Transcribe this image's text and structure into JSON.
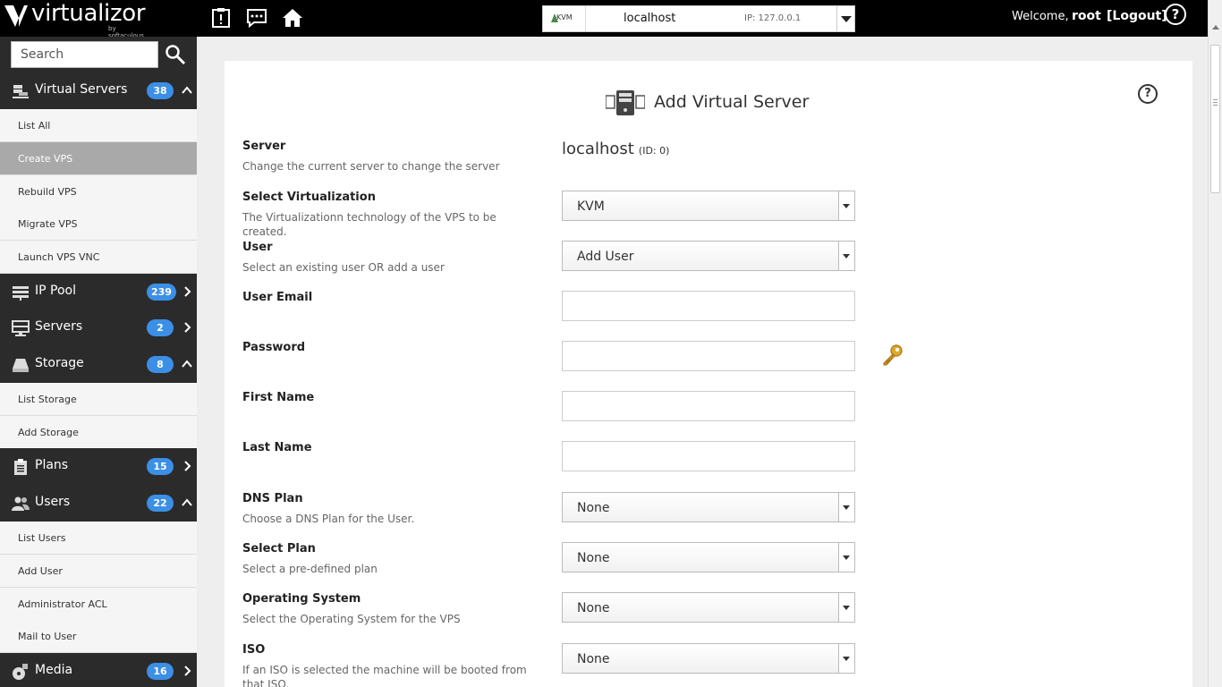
{
  "topbar": {
    "brand": "virtualizor",
    "brand_sub": "by softaculous",
    "server_virt": "KVM",
    "server_host": "localhost",
    "server_ip": "IP: 127.0.0.1",
    "welcome": "Welcome,",
    "username": "root",
    "logout": "[Logout]",
    "help": "?"
  },
  "sidebar": {
    "search_placeholder": "Search",
    "sections": {
      "virtual_servers": {
        "label": "Virtual Servers",
        "badge": "38"
      },
      "ip_pool": {
        "label": "IP Pool",
        "badge": "239"
      },
      "servers": {
        "label": "Servers",
        "badge": "2"
      },
      "storage": {
        "label": "Storage",
        "badge": "8"
      },
      "plans": {
        "label": "Plans",
        "badge": "15"
      },
      "users": {
        "label": "Users",
        "badge": "22"
      },
      "media": {
        "label": "Media",
        "badge": "16"
      }
    },
    "vs_items": [
      "List All",
      "Create VPS",
      "Rebuild VPS",
      "Migrate VPS",
      "Launch VPS VNC"
    ],
    "storage_items": [
      "List Storage",
      "Add Storage"
    ],
    "users_items": [
      "List Users",
      "Add User",
      "Administrator ACL",
      "Mail to User"
    ]
  },
  "form": {
    "title": "Add Virtual Server",
    "help": "?",
    "server": {
      "label": "Server",
      "desc": "Change the current server to change the server",
      "host": "localhost",
      "id": "(ID: 0)"
    },
    "virtualization": {
      "label": "Select Virtualization",
      "desc": "The Virtualizationn technology of the VPS to be created.",
      "value": "KVM"
    },
    "user": {
      "label": "User",
      "desc": "Select an existing user OR add a user",
      "value": "Add User"
    },
    "email": {
      "label": "User Email",
      "value": ""
    },
    "password": {
      "label": "Password",
      "value": ""
    },
    "first_name": {
      "label": "First Name",
      "value": ""
    },
    "last_name": {
      "label": "Last Name",
      "value": ""
    },
    "dns_plan": {
      "label": "DNS Plan",
      "desc": "Choose a DNS Plan for the User.",
      "value": "None"
    },
    "plan": {
      "label": "Select Plan",
      "desc": "Select a pre-defined plan",
      "value": "None"
    },
    "os": {
      "label": "Operating System",
      "desc": "Select the Operating System for the VPS",
      "value": "None"
    },
    "iso": {
      "label": "ISO",
      "desc": "If an ISO is selected the machine will be booted from that ISO.",
      "value": "None"
    }
  },
  "colors": {
    "topbar": "#000000",
    "sidebar": "#2b2b2b",
    "badge": "#3b8fe6",
    "active_item": "#a9a9a9"
  }
}
